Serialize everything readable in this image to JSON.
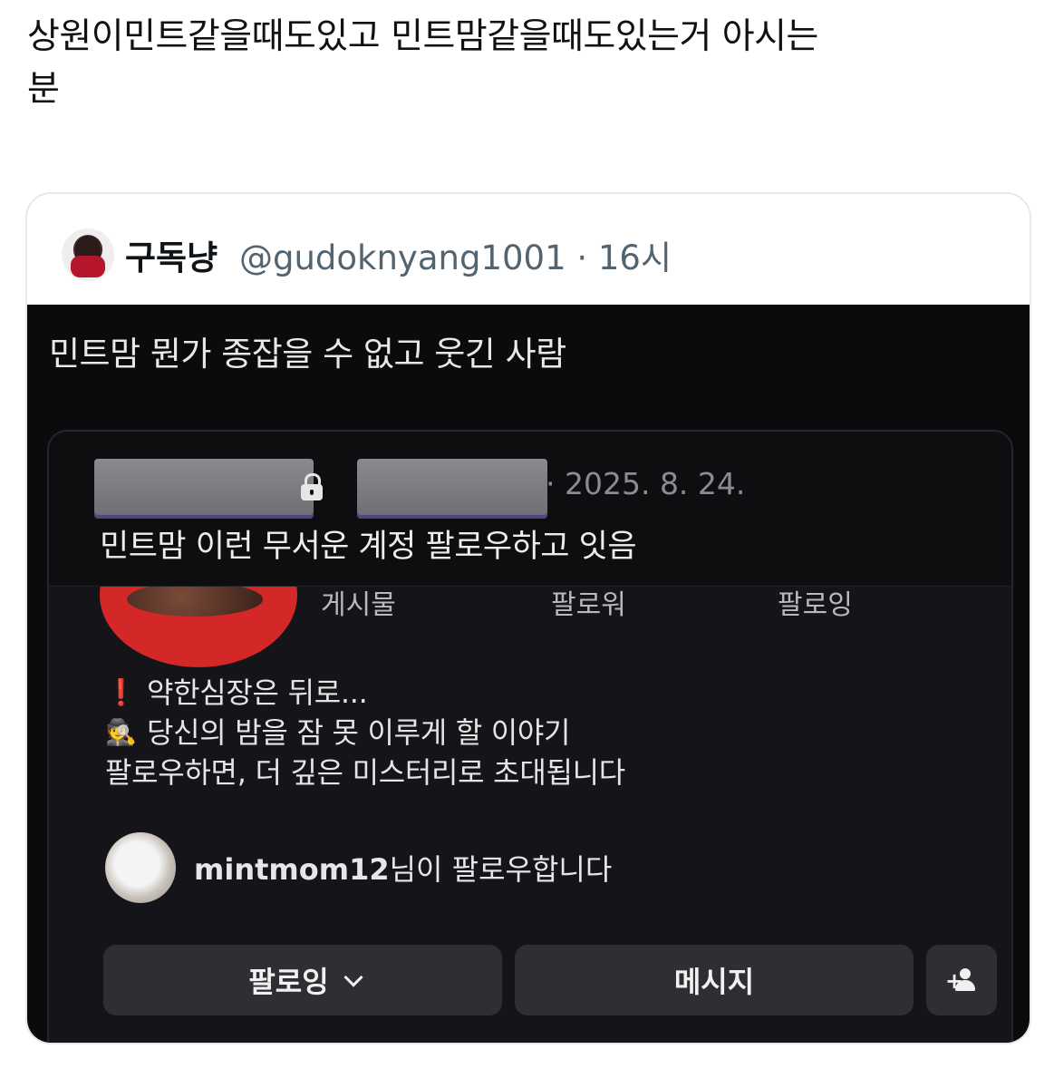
{
  "tweet": {
    "text_line1": "상원이민트같을때도있고 민트맘같을때도있는거 아시는",
    "text_line2": "분"
  },
  "quote": {
    "display_name": "구독냥",
    "handle_time": "@gudoknyang1001 · 16시",
    "media": {
      "caption": "민트맘 뭔가 종잡을 수 없고 웃긴 사람",
      "inner_post": {
        "date": "· 2025. 8. 24.",
        "text": "민트맘 이런 무서운 계정 팔로우하고 잇음"
      },
      "profile": {
        "stats": [
          "게시물",
          "팔로워",
          "팔로잉"
        ],
        "bio": [
          {
            "icon": "exclamation-icon",
            "glyph": "❗",
            "text": "약한심장은 뒤로..."
          },
          {
            "icon": "detective-icon",
            "glyph": "🕵",
            "text": "당신의 밤을 잠 못 이루게 할 이야기"
          },
          {
            "icon": "",
            "glyph": "",
            "text": "팔로우하면, 더 깊은 미스터리로 초대됩니다"
          }
        ],
        "followed_by_user": "mintmom12",
        "followed_by_suffix": "님이 팔로우합니다",
        "buttons": {
          "following": "팔로잉",
          "message": "메시지"
        }
      }
    }
  }
}
